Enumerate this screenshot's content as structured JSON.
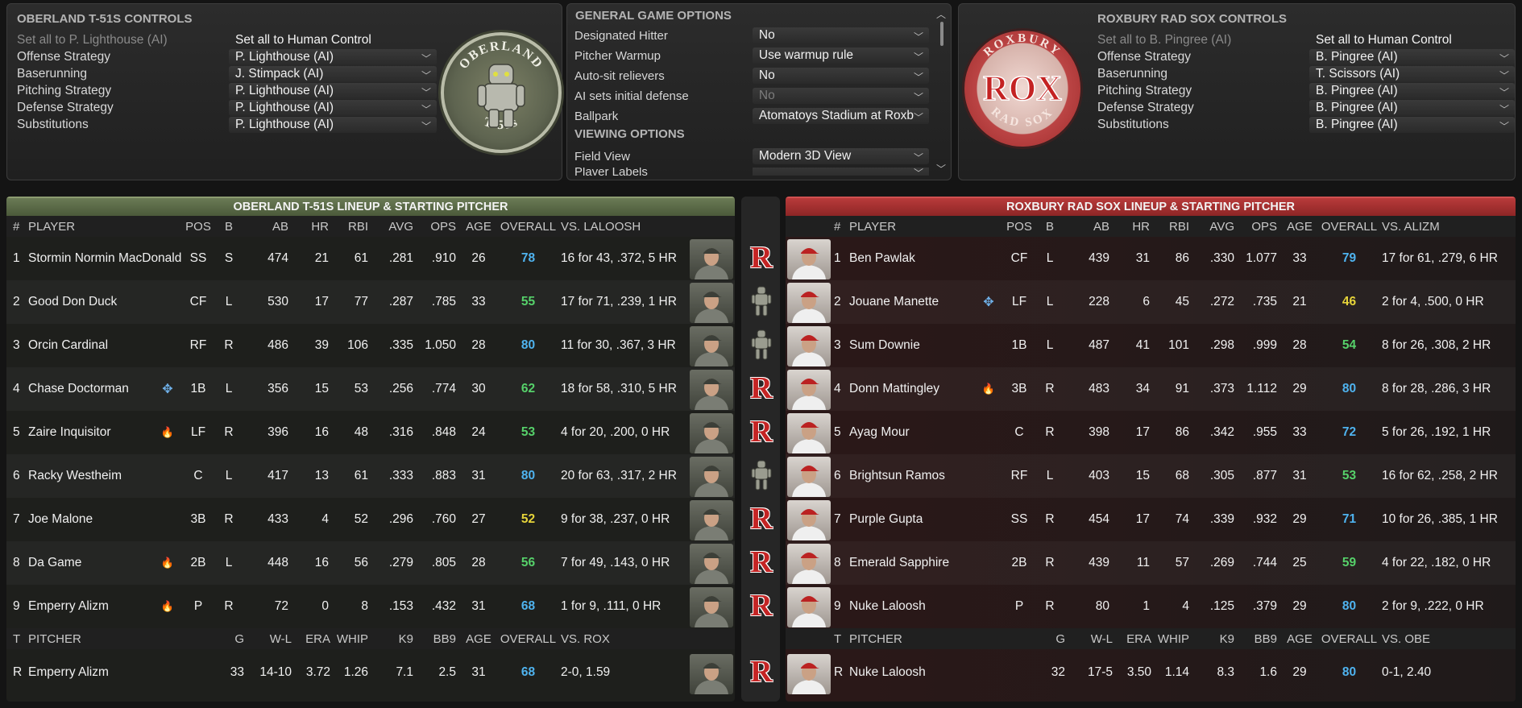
{
  "left_controls": {
    "title": "OBERLAND T-51S CONTROLS",
    "set_ai": "Set all to P. Lighthouse (AI)",
    "set_human": "Set all to Human Control",
    "rows": [
      {
        "label": "Offense Strategy",
        "value": "P. Lighthouse (AI)"
      },
      {
        "label": "Baserunning",
        "value": "J. Stimpack (AI)"
      },
      {
        "label": "Pitching Strategy",
        "value": "P. Lighthouse (AI)"
      },
      {
        "label": "Defense Strategy",
        "value": "P. Lighthouse (AI)"
      },
      {
        "label": "Substitutions",
        "value": "P. Lighthouse (AI)"
      }
    ],
    "logo_top": "OBERLAND",
    "logo_bottom": "T-51s"
  },
  "game_options": {
    "title": "GENERAL GAME OPTIONS",
    "rows": [
      {
        "label": "Designated Hitter",
        "value": "No"
      },
      {
        "label": "Pitcher Warmup",
        "value": "Use warmup rule"
      },
      {
        "label": "Auto-sit relievers",
        "value": "No"
      },
      {
        "label": "AI sets initial defense",
        "value": "No"
      },
      {
        "label": "Ballpark",
        "value": "Atomatoys Stadium at Roxb"
      }
    ],
    "viewing_title": "VIEWING OPTIONS",
    "viewing_rows": [
      {
        "label": "Field View",
        "value": "Modern 3D View"
      },
      {
        "label": "Player Labels",
        "value": ""
      }
    ]
  },
  "right_controls": {
    "title": "ROXBURY RAD SOX CONTROLS",
    "set_ai": "Set all to B. Pingree (AI)",
    "set_human": "Set all to Human Control",
    "rows": [
      {
        "label": "Offense Strategy",
        "value": "B. Pingree (AI)"
      },
      {
        "label": "Baserunning",
        "value": "T. Scissors (AI)"
      },
      {
        "label": "Pitching Strategy",
        "value": "B. Pingree (AI)"
      },
      {
        "label": "Defense Strategy",
        "value": "B. Pingree (AI)"
      },
      {
        "label": "Substitutions",
        "value": "B. Pingree (AI)"
      }
    ],
    "logo_center": "ROX",
    "logo_top": "ROXBURY",
    "logo_bottom": "RAD SOX"
  },
  "colors": {
    "blue": "#4fb3ef",
    "green": "#56d16a",
    "yellow": "#e6d43a"
  },
  "left_lineup": {
    "title": "OBERLAND T-51S LINEUP & STARTING PITCHER",
    "headers": {
      "num": "#",
      "player": "PLAYER",
      "pos": "POS",
      "b": "B",
      "ab": "AB",
      "hr": "HR",
      "rbi": "RBI",
      "avg": "AVG",
      "ops": "OPS",
      "age": "AGE",
      "overall": "OVERALL",
      "vs": "VS. LALOOSH"
    },
    "players": [
      {
        "num": "1",
        "name": "Stormin Normin MacDonald",
        "badge": "",
        "pos": "SS",
        "b": "S",
        "ab": "474",
        "hr": "21",
        "rbi": "61",
        "avg": ".281",
        "ops": ".910",
        "age": "26",
        "overall": "78",
        "ovr_color": "blue",
        "vs": "16 for 43, .372, 5 HR",
        "mid": "R"
      },
      {
        "num": "2",
        "name": "Good Don Duck",
        "badge": "",
        "pos": "CF",
        "b": "L",
        "ab": "530",
        "hr": "17",
        "rbi": "77",
        "avg": ".287",
        "ops": ".785",
        "age": "33",
        "overall": "55",
        "ovr_color": "green",
        "vs": "17 for 71, .239, 1 HR",
        "mid": "robot"
      },
      {
        "num": "3",
        "name": "Orcin Cardinal",
        "badge": "",
        "pos": "RF",
        "b": "R",
        "ab": "486",
        "hr": "39",
        "rbi": "106",
        "avg": ".335",
        "ops": "1.050",
        "age": "28",
        "overall": "80",
        "ovr_color": "blue",
        "vs": "11 for 30, .367, 3 HR",
        "mid": "robot"
      },
      {
        "num": "4",
        "name": "Chase Doctorman",
        "badge": "diamond",
        "pos": "1B",
        "b": "L",
        "ab": "356",
        "hr": "15",
        "rbi": "53",
        "avg": ".256",
        "ops": ".774",
        "age": "30",
        "overall": "62",
        "ovr_color": "green",
        "vs": "18 for 58, .310, 5 HR",
        "mid": "R"
      },
      {
        "num": "5",
        "name": "Zaire Inquisitor",
        "badge": "fire",
        "pos": "LF",
        "b": "R",
        "ab": "396",
        "hr": "16",
        "rbi": "48",
        "avg": ".316",
        "ops": ".848",
        "age": "24",
        "overall": "53",
        "ovr_color": "green",
        "vs": "4 for 20, .200, 0 HR",
        "mid": "R"
      },
      {
        "num": "6",
        "name": "Racky Westheim",
        "badge": "",
        "pos": "C",
        "b": "L",
        "ab": "417",
        "hr": "13",
        "rbi": "61",
        "avg": ".333",
        "ops": ".883",
        "age": "31",
        "overall": "80",
        "ovr_color": "blue",
        "vs": "20 for 63, .317, 2 HR",
        "mid": "robot"
      },
      {
        "num": "7",
        "name": "Joe Malone",
        "badge": "",
        "pos": "3B",
        "b": "R",
        "ab": "433",
        "hr": "4",
        "rbi": "52",
        "avg": ".296",
        "ops": ".760",
        "age": "27",
        "overall": "52",
        "ovr_color": "yellow",
        "vs": "9 for 38, .237, 0 HR",
        "mid": "R"
      },
      {
        "num": "8",
        "name": "Da Game",
        "badge": "fire",
        "pos": "2B",
        "b": "L",
        "ab": "448",
        "hr": "16",
        "rbi": "56",
        "avg": ".279",
        "ops": ".805",
        "age": "28",
        "overall": "56",
        "ovr_color": "green",
        "vs": "7 for 49, .143, 0 HR",
        "mid": "R"
      },
      {
        "num": "9",
        "name": "Emperry Alizm",
        "badge": "fire",
        "pos": "P",
        "b": "R",
        "ab": "72",
        "hr": "0",
        "rbi": "8",
        "avg": ".153",
        "ops": ".432",
        "age": "31",
        "overall": "68",
        "ovr_color": "blue",
        "vs": "1 for 9, .111, 0 HR",
        "mid": "R"
      }
    ],
    "pitcher_headers": {
      "t": "T",
      "pitcher": "PITCHER",
      "g": "G",
      "wl": "W-L",
      "era": "ERA",
      "whip": "WHIP",
      "k9": "K9",
      "bb9": "BB9",
      "age": "AGE",
      "overall": "OVERALL",
      "vs": "VS. ROX"
    },
    "pitcher": {
      "t": "R",
      "name": "Emperry Alizm",
      "g": "33",
      "wl": "14-10",
      "era": "3.72",
      "whip": "1.26",
      "k9": "7.1",
      "bb9": "2.5",
      "age": "31",
      "overall": "68",
      "ovr_color": "blue",
      "vs": "2-0, 1.59",
      "mid": "R"
    }
  },
  "right_lineup": {
    "title": "ROXBURY RAD SOX LINEUP & STARTING PITCHER",
    "headers": {
      "num": "#",
      "player": "PLAYER",
      "pos": "POS",
      "b": "B",
      "ab": "AB",
      "hr": "HR",
      "rbi": "RBI",
      "avg": "AVG",
      "ops": "OPS",
      "age": "AGE",
      "overall": "OVERALL",
      "vs": "VS. ALIZM"
    },
    "players": [
      {
        "num": "1",
        "name": "Ben Pawlak",
        "badge": "",
        "pos": "CF",
        "b": "L",
        "ab": "439",
        "hr": "31",
        "rbi": "86",
        "avg": ".330",
        "ops": "1.077",
        "age": "33",
        "overall": "79",
        "ovr_color": "blue",
        "vs": "17 for 61, .279, 6 HR"
      },
      {
        "num": "2",
        "name": "Jouane Manette",
        "badge": "diamond",
        "pos": "LF",
        "b": "L",
        "ab": "228",
        "hr": "6",
        "rbi": "45",
        "avg": ".272",
        "ops": ".735",
        "age": "21",
        "overall": "46",
        "ovr_color": "yellow",
        "vs": "2 for 4, .500, 0 HR"
      },
      {
        "num": "3",
        "name": "Sum Downie",
        "badge": "",
        "pos": "1B",
        "b": "L",
        "ab": "487",
        "hr": "41",
        "rbi": "101",
        "avg": ".298",
        "ops": ".999",
        "age": "28",
        "overall": "54",
        "ovr_color": "green",
        "vs": "8 for 26, .308, 2 HR"
      },
      {
        "num": "4",
        "name": "Donn Mattingley",
        "badge": "fire",
        "pos": "3B",
        "b": "R",
        "ab": "483",
        "hr": "34",
        "rbi": "91",
        "avg": ".373",
        "ops": "1.112",
        "age": "29",
        "overall": "80",
        "ovr_color": "blue",
        "vs": "8 for 28, .286, 3 HR"
      },
      {
        "num": "5",
        "name": "Ayag Mour",
        "badge": "",
        "pos": "C",
        "b": "R",
        "ab": "398",
        "hr": "17",
        "rbi": "86",
        "avg": ".342",
        "ops": ".955",
        "age": "33",
        "overall": "72",
        "ovr_color": "blue",
        "vs": "5 for 26, .192, 1 HR"
      },
      {
        "num": "6",
        "name": "Brightsun Ramos",
        "badge": "",
        "pos": "RF",
        "b": "L",
        "ab": "403",
        "hr": "15",
        "rbi": "68",
        "avg": ".305",
        "ops": ".877",
        "age": "31",
        "overall": "53",
        "ovr_color": "green",
        "vs": "16 for 62, .258, 2 HR"
      },
      {
        "num": "7",
        "name": "Purple Gupta",
        "badge": "",
        "pos": "SS",
        "b": "R",
        "ab": "454",
        "hr": "17",
        "rbi": "74",
        "avg": ".339",
        "ops": ".932",
        "age": "29",
        "overall": "71",
        "ovr_color": "blue",
        "vs": "10 for 26, .385, 1 HR"
      },
      {
        "num": "8",
        "name": "Emerald Sapphire",
        "badge": "",
        "pos": "2B",
        "b": "R",
        "ab": "439",
        "hr": "11",
        "rbi": "57",
        "avg": ".269",
        "ops": ".744",
        "age": "25",
        "overall": "59",
        "ovr_color": "green",
        "vs": "4 for 22, .182, 0 HR"
      },
      {
        "num": "9",
        "name": "Nuke Laloosh",
        "badge": "",
        "pos": "P",
        "b": "R",
        "ab": "80",
        "hr": "1",
        "rbi": "4",
        "avg": ".125",
        "ops": ".379",
        "age": "29",
        "overall": "80",
        "ovr_color": "blue",
        "vs": "2 for 9, .222, 0 HR"
      }
    ],
    "pitcher_headers": {
      "t": "T",
      "pitcher": "PITCHER",
      "g": "G",
      "wl": "W-L",
      "era": "ERA",
      "whip": "WHIP",
      "k9": "K9",
      "bb9": "BB9",
      "age": "AGE",
      "overall": "OVERALL",
      "vs": "VS. OBE"
    },
    "pitcher": {
      "t": "R",
      "name": "Nuke Laloosh",
      "g": "32",
      "wl": "17-5",
      "era": "3.50",
      "whip": "1.14",
      "k9": "8.3",
      "bb9": "1.6",
      "age": "29",
      "overall": "80",
      "ovr_color": "blue",
      "vs": "0-1, 2.40"
    }
  }
}
